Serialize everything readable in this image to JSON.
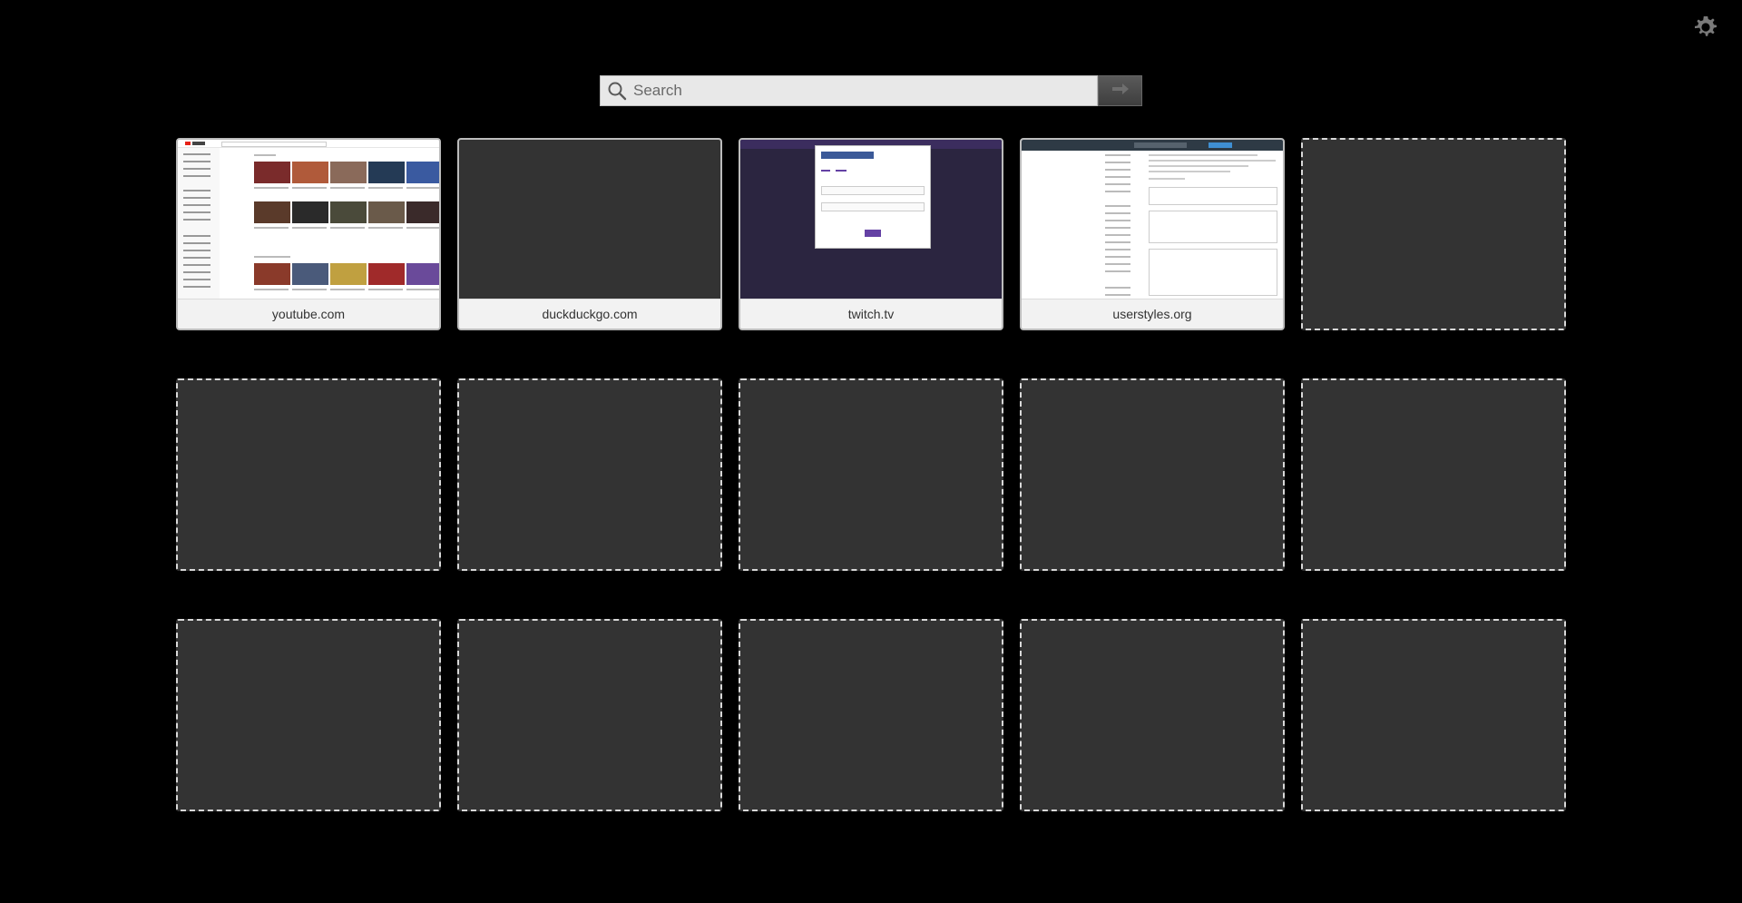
{
  "settings": {
    "icon": "gear-icon"
  },
  "search": {
    "placeholder": "Search",
    "value": "",
    "icon": "search-icon",
    "go_icon": "arrow-right-icon"
  },
  "tiles": [
    {
      "label": "youtube.com",
      "state": "thumbnail"
    },
    {
      "label": "duckduckgo.com",
      "state": "thumbnail"
    },
    {
      "label": "twitch.tv",
      "state": "thumbnail"
    },
    {
      "label": "userstyles.org",
      "state": "thumbnail"
    },
    {
      "label": "",
      "state": "empty"
    },
    {
      "label": "",
      "state": "empty"
    },
    {
      "label": "",
      "state": "empty"
    },
    {
      "label": "",
      "state": "empty"
    },
    {
      "label": "",
      "state": "empty"
    },
    {
      "label": "",
      "state": "empty"
    },
    {
      "label": "",
      "state": "empty"
    },
    {
      "label": "",
      "state": "empty"
    },
    {
      "label": "",
      "state": "empty"
    },
    {
      "label": "",
      "state": "empty"
    },
    {
      "label": "",
      "state": "empty"
    }
  ],
  "colors": {
    "background": "#000000",
    "empty_tile": "#333333",
    "empty_border": "#d8d8d8",
    "label_bar": "#f2f2f2"
  }
}
